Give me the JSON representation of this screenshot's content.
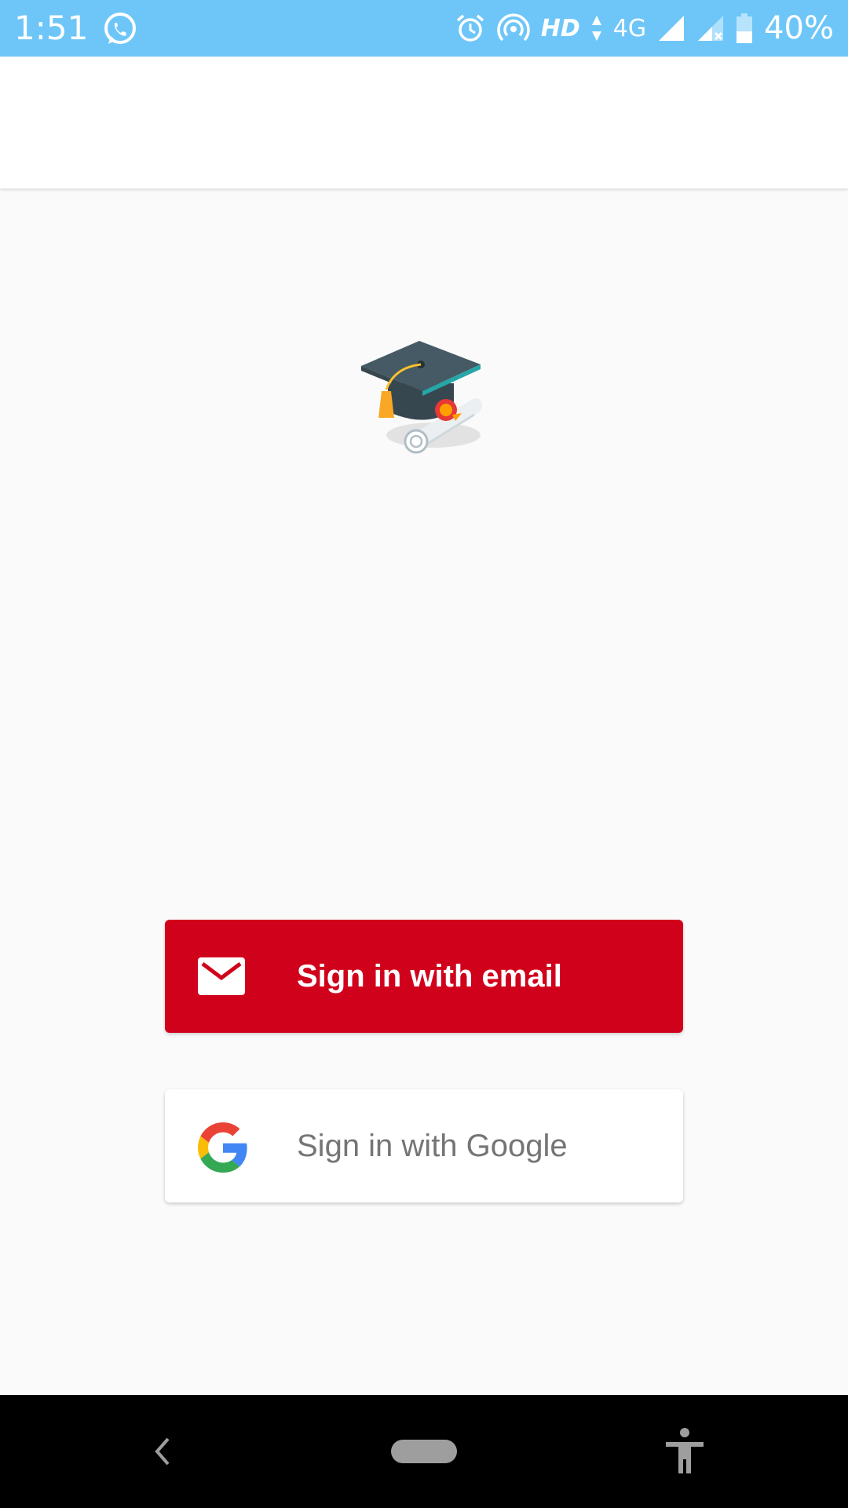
{
  "status_bar": {
    "time": "1:51",
    "left_icon": "whatsapp-icon",
    "hd_label": "HD",
    "network_label": "4G",
    "battery_percent": "40%",
    "right_icons": [
      "alarm-icon",
      "hotspot-icon",
      "data-arrows-icon",
      "signal-icon",
      "signal-no-sim-icon",
      "battery-icon"
    ],
    "background": "#6ec6f8"
  },
  "logo": {
    "icon": "graduation-cap-diploma-icon"
  },
  "buttons": {
    "email": {
      "label": "Sign in with email",
      "icon": "envelope-icon",
      "color": "#d0021b"
    },
    "google": {
      "label": "Sign in with Google",
      "icon": "google-g-icon",
      "color": "#ffffff"
    }
  },
  "nav_bar": {
    "icons": [
      "back-icon",
      "home-pill-icon",
      "accessibility-icon"
    ]
  }
}
